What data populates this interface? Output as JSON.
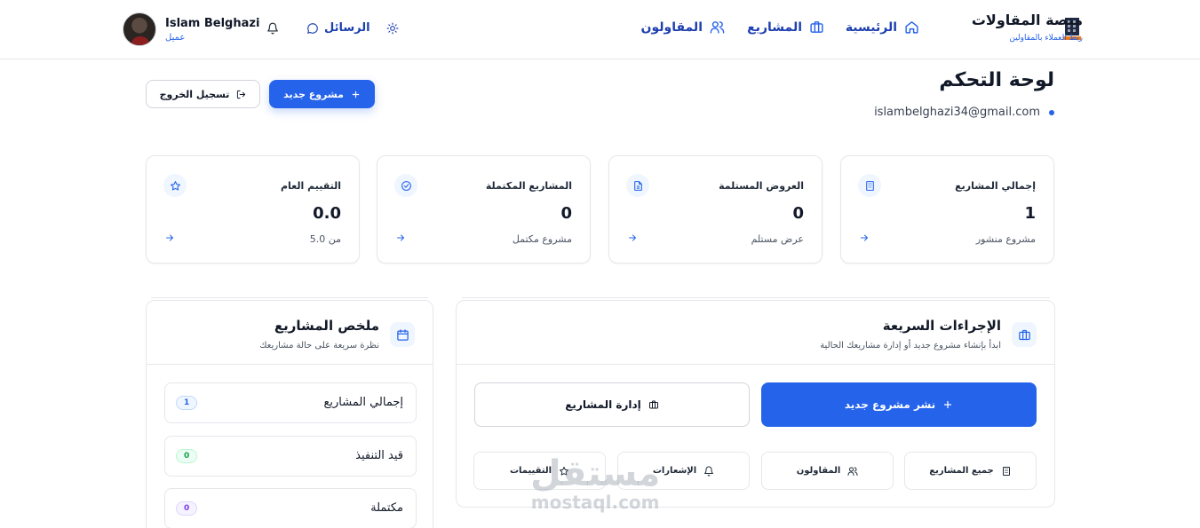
{
  "header": {
    "brand_title": "منصة المقاولات",
    "brand_subtitle": "ربط العملاء بالمقاولين",
    "nav": [
      {
        "label": "الرئيسية",
        "icon": "home-icon"
      },
      {
        "label": "المشاريع",
        "icon": "briefcase-icon"
      },
      {
        "label": "المقاولون",
        "icon": "users-icon"
      }
    ],
    "messages_label": "الرسائل",
    "user_name": "Islam Belghazi",
    "user_role": "عميل"
  },
  "page": {
    "title": "لوحة التحكم",
    "email": "islambelghazi34@gmail.com",
    "new_project_label": "مشروع جديد",
    "logout_label": "تسجيل الخروج"
  },
  "stats": [
    {
      "label": "إجمالي المشاريع",
      "value": "1",
      "sub": "مشروع منشور",
      "icon": "building-icon"
    },
    {
      "label": "العروض المستلمة",
      "value": "0",
      "sub": "عرض مستلم",
      "icon": "document-icon"
    },
    {
      "label": "المشاريع المكتملة",
      "value": "0",
      "sub": "مشروع مكتمل",
      "icon": "check-circle-icon"
    },
    {
      "label": "التقييم العام",
      "value": "0.0",
      "sub": "من 5.0",
      "icon": "star-icon"
    }
  ],
  "quick_actions": {
    "title": "الإجراءات السريعة",
    "subtitle": "ابدأ بإنشاء مشروع جديد أو إدارة مشاريعك الحالية",
    "primary_label": "نشر مشروع جديد",
    "secondary_label": "إدارة المشاريع",
    "links": [
      {
        "label": "جميع المشاريع",
        "icon": "building-icon"
      },
      {
        "label": "المقاولون",
        "icon": "users-icon"
      },
      {
        "label": "الإشعارات",
        "icon": "bell-icon"
      },
      {
        "label": "التقييمات",
        "icon": "star-icon"
      }
    ]
  },
  "summary": {
    "title": "ملخص المشاريع",
    "subtitle": "نظرة سريعة على حالة مشاريعك",
    "rows": [
      {
        "label": "إجمالي المشاريع",
        "count": "1",
        "color": "#2563eb",
        "bg": "#eff6ff"
      },
      {
        "label": "قيد التنفيذ",
        "count": "0",
        "color": "#16a34a",
        "bg": "#ecfdf5"
      },
      {
        "label": "مكتملة",
        "count": "0",
        "color": "#7c3aed",
        "bg": "#f5f3ff"
      }
    ]
  },
  "watermark": {
    "arabic": "مستقل",
    "latin": "mostaql.com"
  },
  "colors": {
    "accent": "#2563eb",
    "nav": "#1e40af"
  }
}
